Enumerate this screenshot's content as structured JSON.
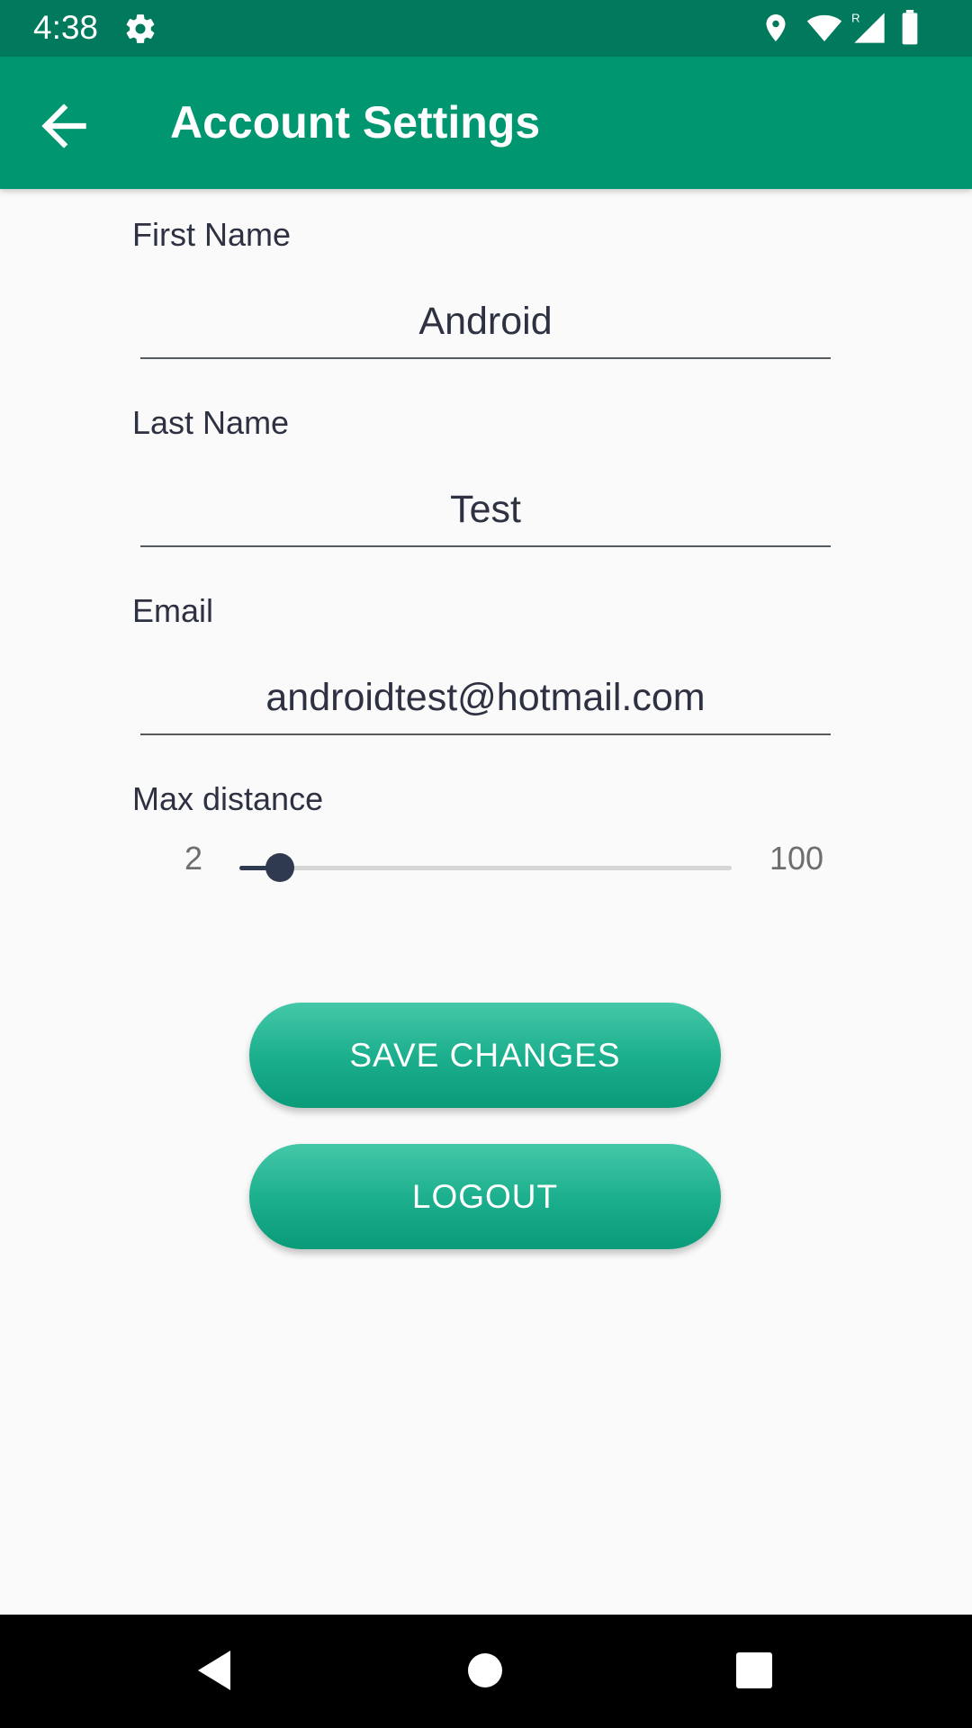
{
  "status_bar": {
    "time": "4:38",
    "icons": [
      "gear-icon",
      "location-icon",
      "wifi-icon",
      "signal-icon",
      "battery-icon"
    ],
    "signal_badge": "R"
  },
  "app_bar": {
    "title": "Account Settings",
    "back_icon": "arrow-back-icon",
    "color": "#009670"
  },
  "form": {
    "first_name": {
      "label": "First Name",
      "value": "Android"
    },
    "last_name": {
      "label": "Last Name",
      "value": "Test"
    },
    "email": {
      "label": "Email",
      "value": "androidtest@hotmail.com"
    },
    "max_distance": {
      "label": "Max distance",
      "min_label": "2",
      "max_label": "100",
      "min": 2,
      "max": 100,
      "value": 10
    }
  },
  "buttons": {
    "save": "SAVE CHANGES",
    "logout": "LOGOUT"
  },
  "colors": {
    "accent": "#009670",
    "status_bar": "#00795c",
    "text": "#2d3142",
    "slider": "#2f3a50"
  },
  "nav_bar": {
    "icons": [
      "back-triangle-icon",
      "home-circle-icon",
      "recents-square-icon"
    ]
  }
}
